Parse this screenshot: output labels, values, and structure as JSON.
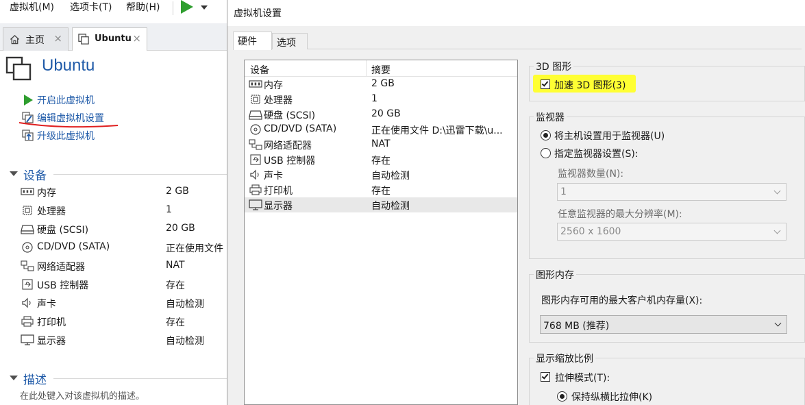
{
  "menu": {
    "vm": "虚拟机(M)",
    "tab": "选项卡(T)",
    "help": "帮助(H)",
    "icons": [
      "play-icon",
      "chevron-down-icon"
    ]
  },
  "tabs": {
    "home": "主页",
    "ubuntu": "Ubuntu",
    "close": "×"
  },
  "vm": {
    "title": "Ubuntu",
    "actions": {
      "start": "开启此虚拟机",
      "edit": "编辑虚拟机设置",
      "upgrade": "升级此虚拟机"
    },
    "devices_heading": "设备",
    "devices": [
      {
        "name": "内存",
        "value": "2 GB",
        "icon": "memory-icon"
      },
      {
        "name": "处理器",
        "value": "1",
        "icon": "cpu-icon"
      },
      {
        "name": "硬盘 (SCSI)",
        "value": "20 GB",
        "icon": "hard-disk-icon"
      },
      {
        "name": "CD/DVD (SATA)",
        "value": "正在使用文件",
        "icon": "cd-dvd-icon"
      },
      {
        "name": "网络适配器",
        "value": "NAT",
        "icon": "network-adapter-icon"
      },
      {
        "name": "USB 控制器",
        "value": "存在",
        "icon": "usb-icon"
      },
      {
        "name": "声卡",
        "value": "自动检测",
        "icon": "speaker-icon"
      },
      {
        "name": "打印机",
        "value": "存在",
        "icon": "printer-icon"
      },
      {
        "name": "显示器",
        "value": "自动检测",
        "icon": "monitor-icon"
      }
    ],
    "description_heading": "描述",
    "description_hint": "在此处键入对该虚拟机的描述。"
  },
  "dialog": {
    "title": "虚拟机设置",
    "tabs": {
      "hardware": "硬件",
      "options": "选项"
    },
    "list_header": {
      "device": "设备",
      "summary": "摘要"
    },
    "hardware": [
      {
        "name": "内存",
        "value": "2 GB"
      },
      {
        "name": "处理器",
        "value": "1"
      },
      {
        "name": "硬盘 (SCSI)",
        "value": "20 GB"
      },
      {
        "name": "CD/DVD (SATA)",
        "value": "正在使用文件 D:\\迅雷下载\\u..."
      },
      {
        "name": "网络适配器",
        "value": "NAT"
      },
      {
        "name": "USB 控制器",
        "value": "存在"
      },
      {
        "name": "声卡",
        "value": "自动检测"
      },
      {
        "name": "打印机",
        "value": "存在"
      },
      {
        "name": "显示器",
        "value": "自动检测",
        "selected": true
      }
    ],
    "graphics3d": {
      "group": "3D 图形",
      "accelerate": "加速 3D 图形(3)",
      "accelerate_checked": true,
      "highlight_color": "#ffff33"
    },
    "monitor": {
      "group": "监视器",
      "use_host": "将主机设置用于监视器(U)",
      "specify": "指定监视器设置(S):",
      "count_label": "监视器数量(N):",
      "count_value": "1",
      "maxres_label": "任意监视器的最大分辨率(M):",
      "maxres_value": "2560 x 1600"
    },
    "graphics_memory": {
      "group": "图形内存",
      "label": "图形内存可用的最大客户机内存量(X):",
      "value": "768 MB (推荐)"
    },
    "display_scaling": {
      "group": "显示缩放比例",
      "stretch": "拉伸模式(T):",
      "stretch_checked": true,
      "keep_aspect": "保持纵横比拉伸(K)"
    }
  },
  "colors": {
    "link_blue": "#1f5aa8",
    "play_green": "#2f9e2f",
    "annotation_red": "#e02020"
  }
}
